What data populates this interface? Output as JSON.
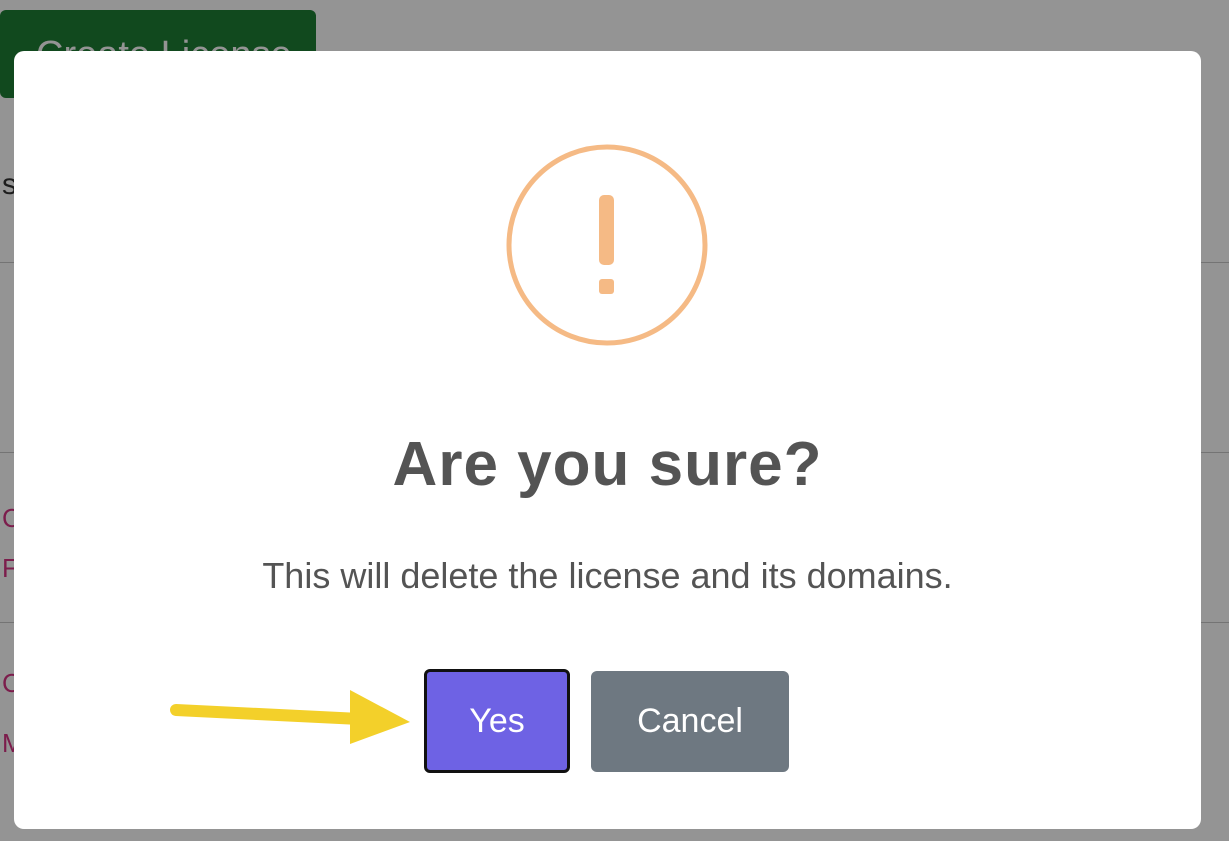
{
  "background": {
    "create_button_label": "Create License",
    "edge_letter": "s",
    "edge_pink_letters": [
      "C",
      "F",
      "C",
      "M"
    ]
  },
  "dialog": {
    "icon": "exclamation-circle-icon",
    "title": "Are you sure?",
    "message": "This will delete the license and its domains.",
    "confirm_label": "Yes",
    "cancel_label": "Cancel"
  },
  "annotation": {
    "arrow": "yellow-arrow-icon"
  },
  "colors": {
    "warning": "#f5ba85",
    "confirm": "#6e62e4",
    "cancel": "#6e7881",
    "create_button": "#1e7e34",
    "arrow": "#f3d02a"
  }
}
